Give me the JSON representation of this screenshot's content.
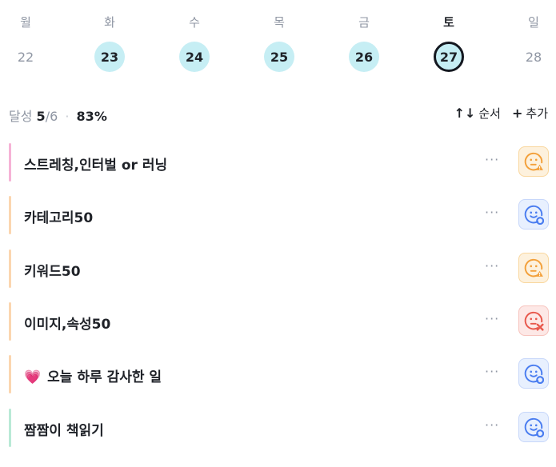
{
  "week": {
    "days": [
      {
        "dow": "월",
        "date": "22",
        "state": "plain"
      },
      {
        "dow": "화",
        "date": "23",
        "state": "done"
      },
      {
        "dow": "수",
        "date": "24",
        "state": "done"
      },
      {
        "dow": "목",
        "date": "25",
        "state": "done"
      },
      {
        "dow": "금",
        "date": "26",
        "state": "done"
      },
      {
        "dow": "토",
        "date": "27",
        "state": "today"
      },
      {
        "dow": "일",
        "date": "28",
        "state": "plain"
      }
    ]
  },
  "summary": {
    "label": "달성",
    "done": "5",
    "slash": "/",
    "total": "6",
    "separator": "·",
    "percent": "83%"
  },
  "actions": {
    "sort_icon": "↑↓",
    "sort_label": "순서",
    "add_icon": "+",
    "add_label": "추가"
  },
  "tasks": [
    {
      "title": "스트레칭,인터벌 or 러닝",
      "bar_color": "#f6b3d6",
      "status": "warn",
      "status_icon": "face-warning-icon"
    },
    {
      "title": "카테고리50",
      "bar_color": "#fbd6b0",
      "status": "ok",
      "status_icon": "face-check-icon"
    },
    {
      "title": "키워드50",
      "bar_color": "#fbd6b0",
      "status": "warn",
      "status_icon": "face-warning-icon"
    },
    {
      "title": "이미지,속성50",
      "bar_color": "#fbd6b0",
      "status": "fail",
      "status_icon": "face-fail-icon"
    },
    {
      "title": "오늘 하루 감사한 일",
      "bar_color": "#fbd6b0",
      "status": "ok",
      "status_icon": "face-check-icon",
      "emoji": "💗"
    },
    {
      "title": "짬짬이 책읽기",
      "bar_color": "#b9ead6",
      "status": "ok",
      "status_icon": "face-check-icon"
    }
  ],
  "more_label": "···",
  "colors": {
    "warn": "#f3a03a",
    "ok": "#4a7df0",
    "fail": "#e8584c",
    "circle_done": "#c6eef4",
    "today_ring": "#141820"
  }
}
